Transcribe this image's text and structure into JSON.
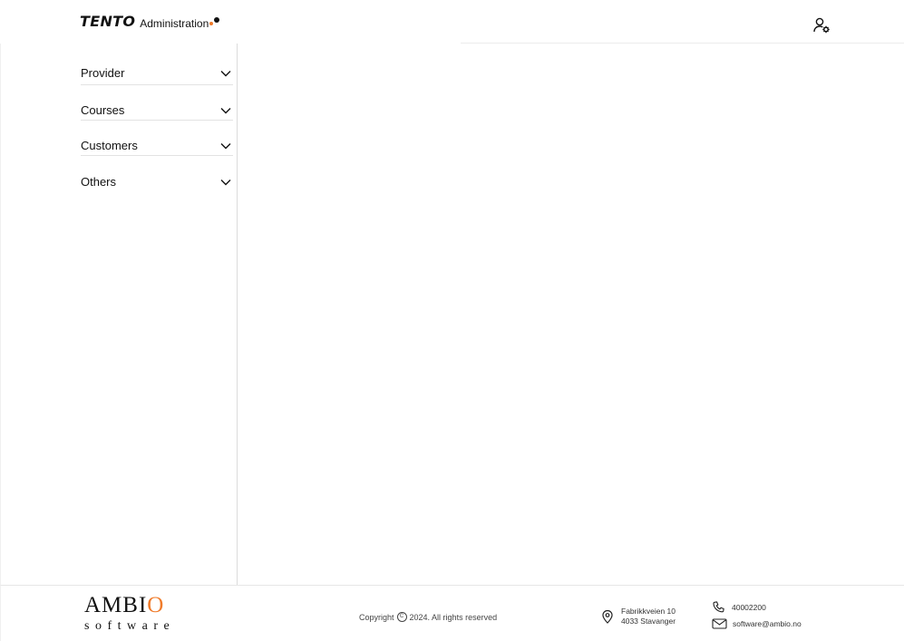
{
  "header": {
    "logo_main": "TENTO",
    "logo_sub": "Administration",
    "user_menu_icon": "user-settings-icon"
  },
  "sidebar": {
    "items": [
      {
        "label": "Provider",
        "icon": "chevron-down-icon"
      },
      {
        "label": "Courses",
        "icon": "chevron-down-icon"
      },
      {
        "label": "Customers",
        "icon": "chevron-down-icon"
      },
      {
        "label": "Others",
        "icon": "chevron-down-icon"
      }
    ]
  },
  "footer": {
    "brand_top": "AMBI",
    "brand_o": "O",
    "brand_bottom": "software",
    "copyright_prefix": "Copyright",
    "copyright_symbol": "C",
    "copyright_suffix": "2024. All rights reserved",
    "address_line1": "Fabrikkveien 10",
    "address_line2": "4033 Stavanger",
    "phone": "40002200",
    "email": "software@ambio.no"
  },
  "colors": {
    "accent": "#f07b2a",
    "text": "#111111",
    "border": "#dcdcdc"
  }
}
